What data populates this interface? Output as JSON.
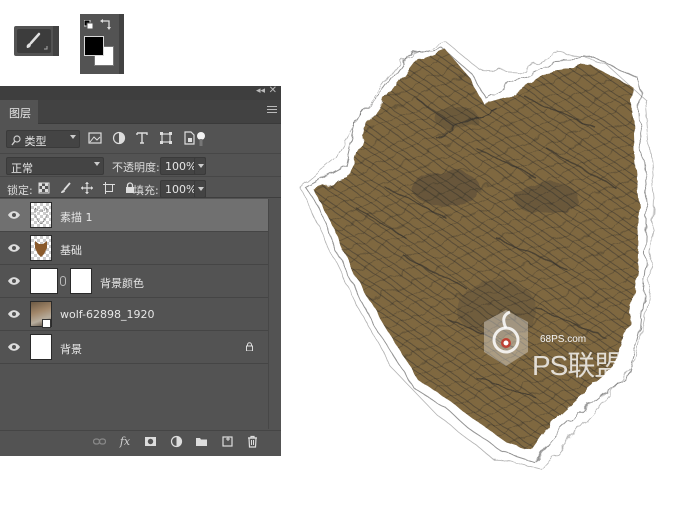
{
  "toolbar": {
    "brush_icon": "brush-icon",
    "fg_color": "#000000",
    "bg_color": "#ffffff"
  },
  "layers_panel": {
    "tab_label": "图层",
    "filter": {
      "label": "类型"
    },
    "blend_mode": "正常",
    "opacity_label": "不透明度:",
    "opacity_value": "100%",
    "lock_label": "锁定:",
    "fill_label": "填充:",
    "fill_value": "100%",
    "layers": [
      {
        "name": "素描 1",
        "selected": true,
        "thumb": "transparent-sketch"
      },
      {
        "name": "基础",
        "selected": false,
        "thumb": "wolf-cutout"
      },
      {
        "name": "背景颜色",
        "selected": false,
        "thumb": "white-with-mask"
      },
      {
        "name": "wolf-62898_1920",
        "selected": false,
        "thumb": "photo-smart-object"
      },
      {
        "name": "背景",
        "selected": false,
        "thumb": "white",
        "locked": true
      }
    ],
    "bottom_icons": [
      "link-icon",
      "fx-icon",
      "mask-icon",
      "adjustment-icon",
      "folder-icon",
      "new-layer-icon",
      "trash-icon"
    ],
    "fx_label": "fx"
  },
  "canvas": {
    "artwork_colors": {
      "fill": "#7f6840",
      "stroke": "#2b2b2b"
    },
    "watermark": {
      "url": "68PS.com",
      "text": "PS联盟"
    }
  }
}
